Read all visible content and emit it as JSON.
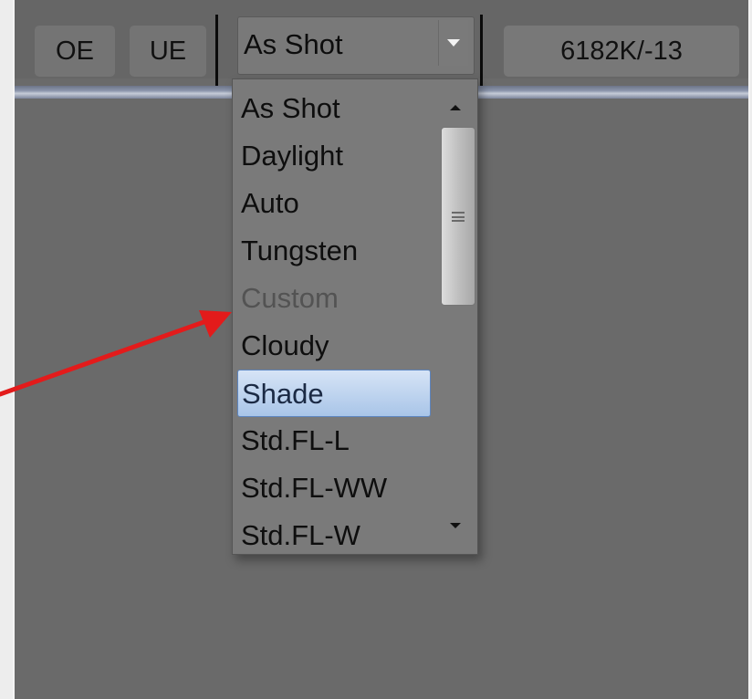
{
  "toolbar": {
    "oe_label": "OE",
    "ue_label": "UE",
    "white_balance_value": "As Shot",
    "temp_tint": "6182K/-13"
  },
  "dropdown": {
    "options": [
      {
        "label": "As Shot",
        "state": "normal"
      },
      {
        "label": "Daylight",
        "state": "normal"
      },
      {
        "label": "Auto",
        "state": "normal"
      },
      {
        "label": "Tungsten",
        "state": "normal"
      },
      {
        "label": "Custom",
        "state": "disabled"
      },
      {
        "label": "Cloudy",
        "state": "normal"
      },
      {
        "label": "Shade",
        "state": "highlighted"
      },
      {
        "label": "Std.FL-L",
        "state": "normal"
      },
      {
        "label": "Std.FL-WW",
        "state": "normal"
      },
      {
        "label": "Std.FL-W",
        "state": "normal"
      }
    ]
  },
  "annotation": {
    "color": "#e31b1b",
    "points_to": "Custom"
  },
  "colors": {
    "panel_bg": "#6a6a6a",
    "highlight": "#b9d1ef"
  },
  "icons": [
    "chevron-down-icon",
    "scroll-up-icon",
    "scroll-down-icon",
    "scroll-thumb-grip-icon",
    "annotation-arrow-icon"
  ]
}
